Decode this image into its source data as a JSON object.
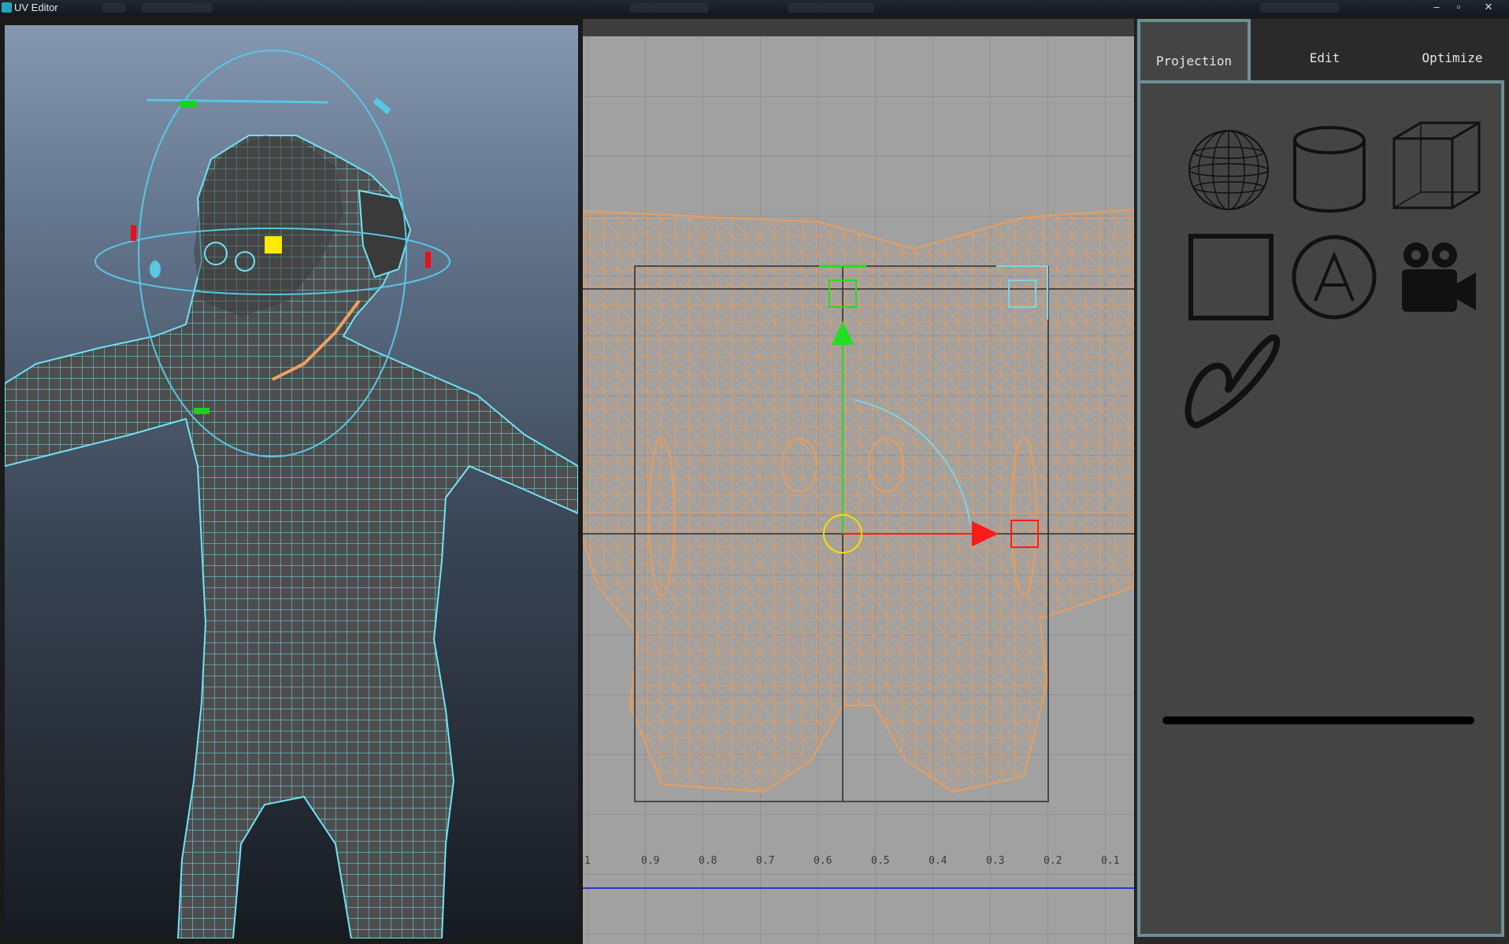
{
  "window": {
    "title": "UV Editor",
    "controls": {
      "minimize": "–",
      "restore": "▫",
      "close": "✕"
    }
  },
  "uv_editor": {
    "axis_labels": [
      "1",
      "0.9",
      "0.8",
      "0.7",
      "0.6",
      "0.5",
      "0.4",
      "0.3",
      "0.2",
      "0.1"
    ],
    "colors": {
      "background": "#a1a1a1",
      "wireframe": "#e79d5d",
      "axis_u": "#ff1a1a",
      "axis_v": "#22dd22",
      "rotate_ring": "#7fd3e4",
      "center_ring": "#f2e100"
    }
  },
  "viewport": {
    "colors": {
      "wireframe": "#6fe3f5",
      "skin": "#4a4a4a",
      "manip": "#57c7e3",
      "handle_yellow": "#ffea00",
      "handle_red": "#e41414",
      "handle_green": "#1ad31a"
    }
  },
  "panel": {
    "tabs": [
      {
        "label": "Projection",
        "active": true
      },
      {
        "label": "Edit",
        "active": false
      },
      {
        "label": "Optimize",
        "active": false
      }
    ],
    "tools": [
      {
        "name": "spherical-projection-icon"
      },
      {
        "name": "cylindrical-projection-icon"
      },
      {
        "name": "cube-projection-icon"
      },
      {
        "name": "planar-projection-icon"
      },
      {
        "name": "automatic-projection-icon",
        "glyph": "A"
      },
      {
        "name": "camera-projection-icon"
      },
      {
        "name": "contour-stretch-icon"
      }
    ],
    "accent": "#6e8f92"
  }
}
